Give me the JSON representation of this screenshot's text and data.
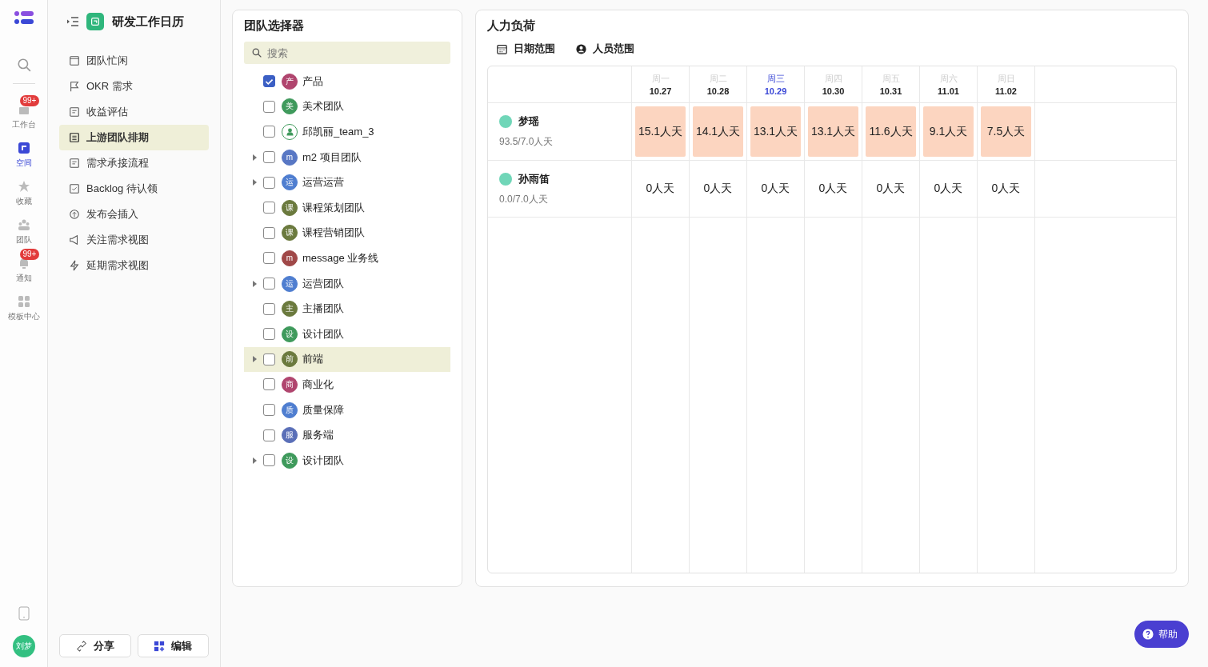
{
  "rail": {
    "items": [
      {
        "label": "工作台",
        "badge": "99+",
        "selected": false
      },
      {
        "label": "空间",
        "selected": true
      },
      {
        "label": "收藏",
        "selected": false
      },
      {
        "label": "团队",
        "selected": false
      },
      {
        "label": "通知",
        "badge": "99+",
        "selected": false
      },
      {
        "label": "模板中心",
        "selected": false
      }
    ],
    "avatar": "刘梦"
  },
  "nav": {
    "title": "研发工作日历",
    "items": [
      {
        "label": "团队忙闲",
        "selected": false
      },
      {
        "label": "OKR 需求",
        "selected": false
      },
      {
        "label": "收益评估",
        "selected": false
      },
      {
        "label": "上游团队排期",
        "selected": true
      },
      {
        "label": "需求承接流程",
        "selected": false
      },
      {
        "label": "Backlog 待认领",
        "selected": false
      },
      {
        "label": "发布会插入",
        "selected": false
      },
      {
        "label": "关注需求视图",
        "selected": false
      },
      {
        "label": "延期需求视图",
        "selected": false
      }
    ],
    "buttons": [
      "分享",
      "编辑"
    ]
  },
  "team_selector": {
    "title": "团队选择器",
    "search": {
      "placeholder": "搜索"
    },
    "teams": [
      {
        "name": "产品",
        "avatar": "产",
        "color": "#b0456e",
        "checked": true,
        "expandable": false,
        "highlighted": false
      },
      {
        "name": "美术团队",
        "avatar": "美",
        "color": "#3f9a5c",
        "checked": false,
        "expandable": false,
        "highlighted": false
      },
      {
        "name": "邱凯丽_team_3",
        "color": "#ffffff",
        "checked": false,
        "expandable": false,
        "highlighted": false
      },
      {
        "name": "m2 项目团队",
        "avatar": "m",
        "color": "#5877c4",
        "checked": false,
        "expandable": true,
        "highlighted": false
      },
      {
        "name": "运营运营",
        "avatar": "运",
        "color": "#4f7ed0",
        "checked": false,
        "expandable": true,
        "highlighted": false
      },
      {
        "name": "课程策划团队",
        "avatar": "课",
        "color": "#6b7a3e",
        "checked": false,
        "expandable": false,
        "highlighted": false
      },
      {
        "name": "课程营销团队",
        "avatar": "课",
        "color": "#6b7a3e",
        "checked": false,
        "expandable": false,
        "highlighted": false
      },
      {
        "name": "message 业务线",
        "avatar": "m",
        "color": "#a04848",
        "checked": false,
        "expandable": false,
        "highlighted": false
      },
      {
        "name": "运营团队",
        "avatar": "运",
        "color": "#4f7ed0",
        "checked": false,
        "expandable": true,
        "highlighted": false
      },
      {
        "name": "主播团队",
        "avatar": "主",
        "color": "#6b7a3e",
        "checked": false,
        "expandable": false,
        "highlighted": false
      },
      {
        "name": "设计团队",
        "avatar": "设",
        "color": "#3f9a5c",
        "checked": false,
        "expandable": false,
        "highlighted": false
      },
      {
        "name": "前端",
        "avatar": "前",
        "color": "#6b7a3e",
        "checked": false,
        "expandable": true,
        "highlighted": true
      },
      {
        "name": "商业化",
        "avatar": "商",
        "color": "#b0456e",
        "checked": false,
        "expandable": false,
        "highlighted": false
      },
      {
        "name": "质量保障",
        "avatar": "质",
        "color": "#4f7ed0",
        "checked": false,
        "expandable": false,
        "highlighted": false
      },
      {
        "name": "服务端",
        "avatar": "服",
        "color": "#5a6fb8",
        "checked": false,
        "expandable": false,
        "highlighted": false
      },
      {
        "name": "设计团队",
        "avatar": "设",
        "color": "#3f9a5c",
        "checked": false,
        "expandable": true,
        "highlighted": false
      }
    ]
  },
  "workload": {
    "title": "人力负荷",
    "filters": [
      "日期范围",
      "人员范围"
    ],
    "days": [
      {
        "weekday": "周一",
        "date": "10.27",
        "today": false
      },
      {
        "weekday": "周二",
        "date": "10.28",
        "today": false
      },
      {
        "weekday": "周三",
        "date": "10.29",
        "today": true
      },
      {
        "weekday": "周四",
        "date": "10.30",
        "today": false
      },
      {
        "weekday": "周五",
        "date": "10.31",
        "today": false
      },
      {
        "weekday": "周六",
        "date": "11.01",
        "today": false
      },
      {
        "weekday": "周日",
        "date": "11.02",
        "today": false
      }
    ],
    "people": [
      {
        "name": "梦瑶",
        "total": "93.5/7.0人天",
        "cells": [
          {
            "text": "15.1人天",
            "overloaded": true
          },
          {
            "text": "14.1人天",
            "overloaded": true
          },
          {
            "text": "13.1人天",
            "overloaded": true
          },
          {
            "text": "13.1人天",
            "overloaded": true
          },
          {
            "text": "11.6人天",
            "overloaded": true
          },
          {
            "text": "9.1人天",
            "overloaded": true
          },
          {
            "text": "7.5人天",
            "overloaded": true
          }
        ]
      },
      {
        "name": "孙雨笛",
        "total": "0.0/7.0人天",
        "cells": [
          {
            "text": "0人天",
            "overloaded": false
          },
          {
            "text": "0人天",
            "overloaded": false
          },
          {
            "text": "0人天",
            "overloaded": false
          },
          {
            "text": "0人天",
            "overloaded": false
          },
          {
            "text": "0人天",
            "overloaded": false
          },
          {
            "text": "0人天",
            "overloaded": false
          },
          {
            "text": "0人天",
            "overloaded": false
          }
        ]
      }
    ]
  },
  "help_button": "帮助"
}
